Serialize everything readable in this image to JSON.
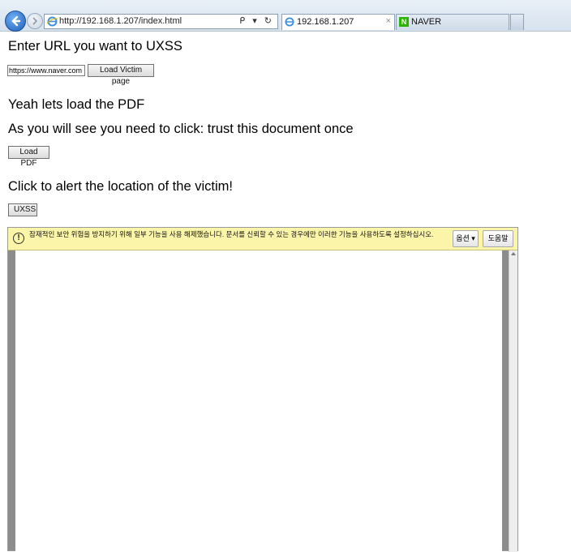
{
  "browser": {
    "address_url": "http://192.168.1.207/index.html",
    "address_tools": "ᑭ ▾ ↻",
    "tabs": [
      {
        "label": "192.168.1.207",
        "close": "×"
      },
      {
        "label": "NAVER"
      }
    ]
  },
  "page": {
    "heading_uxss": "Enter URL you want to UXSS",
    "url_input_value": "https://www.naver.com",
    "load_victim_label": "Load Victim page",
    "heading_pdf": "Yeah lets load the PDF",
    "heading_trust": "As you will see you need to click: trust this document once",
    "load_pdf_label": "Load PDF",
    "heading_alert": "Click to alert the location of the victim!",
    "uxss_label": "UXSS"
  },
  "pdf_frame": {
    "info_icon": "!",
    "info_message": "잠재적인 보안 위험을 방지하기 위해 일부 기능을 사용 해제했습니다. 문서를 신뢰할 수 있는 경우에만 이러한 기능을 사용하도록 설정하십시오.",
    "options_label": "옵션 ▾",
    "help_label": "도움말"
  },
  "colors": {
    "infobar_bg": "#fbf5a9",
    "back_button": "#1f5fb8",
    "naver_green": "#2db400"
  }
}
